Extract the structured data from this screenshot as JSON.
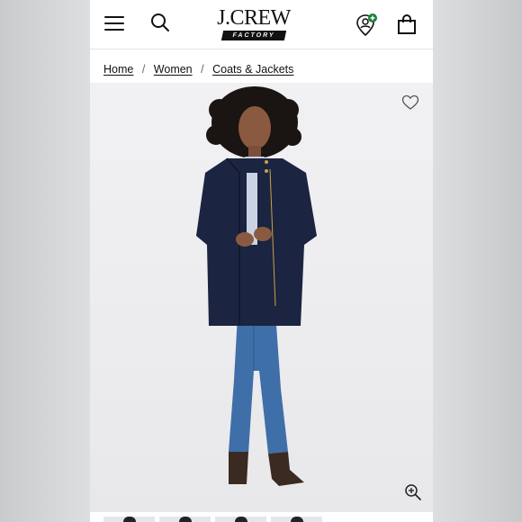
{
  "brand": {
    "name": "J.CREW",
    "subline": "FACTORY"
  },
  "header": {
    "menu_icon": "hamburger-menu-icon",
    "search_icon": "search-icon",
    "account_icon": "account-location-icon",
    "bag_icon": "shopping-bag-icon",
    "account_badge_color": "#1a7f37"
  },
  "breadcrumb": [
    {
      "label": "Home"
    },
    {
      "label": "Women"
    },
    {
      "label": "Coats & Jackets"
    }
  ],
  "product_image": {
    "subject": "Model wearing navy stand-collar coat with wide-leg jeans",
    "wishlist_icon": "heart-icon",
    "zoom_icon": "zoom-in-icon"
  },
  "thumbnails": {
    "count": 4,
    "selected": 0
  },
  "colors": {
    "coat": "#1b2440",
    "denim": "#3f6fa8",
    "boots": "#3b2a22",
    "background": "#efeff1"
  }
}
